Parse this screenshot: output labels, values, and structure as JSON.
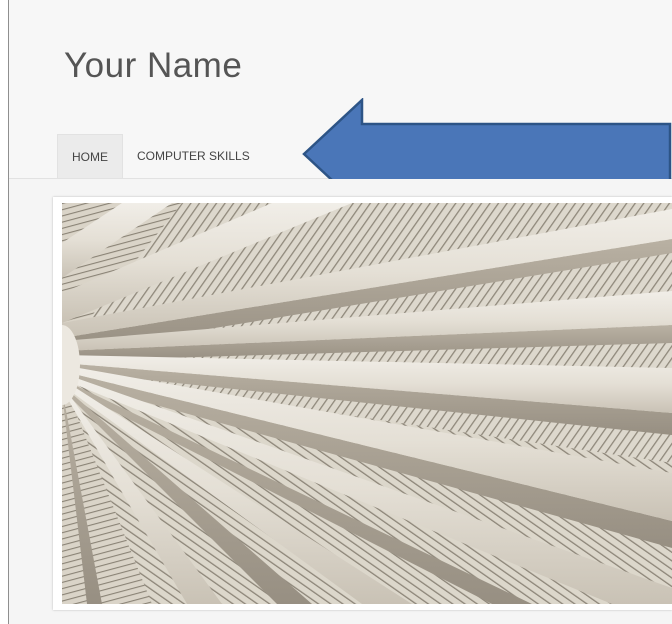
{
  "site": {
    "title": "Your Name"
  },
  "nav": {
    "items": [
      {
        "label": "HOME",
        "active": true
      },
      {
        "label": "COMPUTER SKILLS",
        "active": false
      }
    ]
  },
  "annotation": {
    "arrow_color": "#4a76b8",
    "arrow_outline": "#2d5486",
    "points_to": "COMPUTER SKILLS"
  },
  "hero": {
    "image": "wooden-ceiling-beams-photo"
  }
}
